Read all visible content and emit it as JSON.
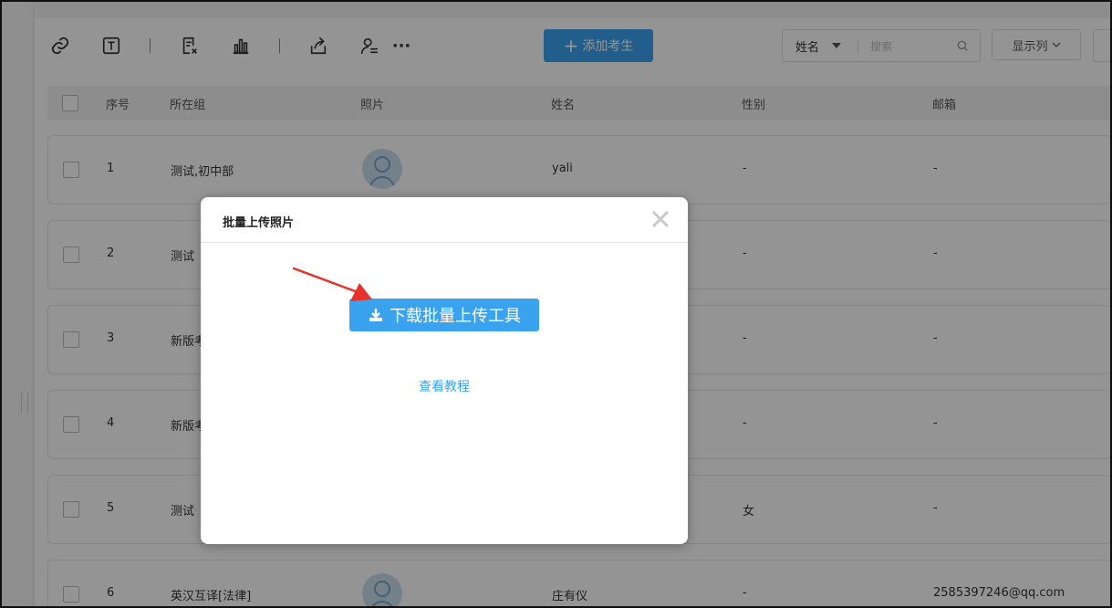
{
  "toolbar": {
    "icons": [
      "link-icon",
      "text-box-icon",
      "sheet-delete-icon",
      "bar-chart-icon",
      "export-icon",
      "user-list-icon",
      "more-icon"
    ],
    "more_label": "···",
    "add_button_label": "添加考生",
    "search": {
      "field_label": "姓名",
      "placeholder": "搜索"
    },
    "columns_button_label": "显示列"
  },
  "table": {
    "headers": [
      "序号",
      "所在组",
      "照片",
      "姓名",
      "性别",
      "邮箱"
    ],
    "rows": [
      {
        "index": "1",
        "group": "测试,初中部",
        "has_photo": true,
        "name": "yali",
        "gender": "-",
        "email": "-"
      },
      {
        "index": "2",
        "group": "测试",
        "has_photo": false,
        "name": "",
        "gender": "-",
        "email": "-"
      },
      {
        "index": "3",
        "group": "新版考",
        "has_photo": false,
        "name": "",
        "gender": "-",
        "email": "-"
      },
      {
        "index": "4",
        "group": "新版考",
        "has_photo": false,
        "name": "",
        "gender": "-",
        "email": "-"
      },
      {
        "index": "5",
        "group": "测试",
        "has_photo": false,
        "name": "",
        "gender": "女",
        "email": "-"
      },
      {
        "index": "6",
        "group": "英汉互译[法律]",
        "has_photo": true,
        "name": "庄有仪",
        "gender": "-",
        "email": "2585397246@qq.com"
      }
    ]
  },
  "modal": {
    "title": "批量上传照片",
    "download_button_label": "下载批量上传工具",
    "tutorial_link": "查看教程"
  },
  "colors": {
    "primary": "#3aa3f0",
    "arrow": "#e8312b"
  }
}
